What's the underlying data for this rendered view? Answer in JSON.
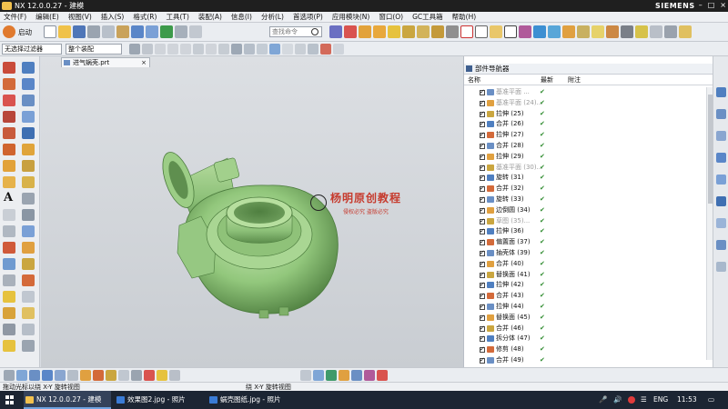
{
  "window": {
    "title": "NX 12.0.0.27 - 建模",
    "brand": "SIEMENS",
    "controls": [
      "–",
      "□",
      "×"
    ]
  },
  "menu": [
    "文件(F)",
    "编辑(E)",
    "视图(V)",
    "插入(S)",
    "格式(R)",
    "工具(T)",
    "装配(A)",
    "信息(I)",
    "分析(L)",
    "首选项(P)",
    "应用模块(N)",
    "窗口(O)",
    "GC工具箱",
    "帮助(H)"
  ],
  "toolbar": {
    "start_label": "启动",
    "search_placeholder": "查找命令",
    "filter_label": "无选择过滤器",
    "assembly_label": "整个装配"
  },
  "document_tab": {
    "label": "进气蜗壳.prt",
    "close": "×"
  },
  "watermark": {
    "title": "杨明原创教程",
    "subtitle": "侵权必究 盗版必究"
  },
  "navigator": {
    "title": "部件导航器",
    "columns": [
      "名称",
      "最新",
      "附注"
    ],
    "rows": [
      {
        "name": "基准平面 ...",
        "grey": true
      },
      {
        "name": "基准平面 (24)...",
        "grey": true
      },
      {
        "name": "拉伸 (25)",
        "grey": false
      },
      {
        "name": "合并 (26)",
        "grey": false
      },
      {
        "name": "拉伸 (27)",
        "grey": false
      },
      {
        "name": "合并 (28)",
        "grey": false
      },
      {
        "name": "拉伸 (29)",
        "grey": false
      },
      {
        "name": "基准平面 (30)...",
        "grey": true
      },
      {
        "name": "旋转 (31)",
        "grey": false
      },
      {
        "name": "合并 (32)",
        "grey": false
      },
      {
        "name": "旋转 (33)",
        "grey": false
      },
      {
        "name": "边倒圆 (34)",
        "grey": false
      },
      {
        "name": "草图 (35)...",
        "grey": true
      },
      {
        "name": "拉伸 (36)",
        "grey": false
      },
      {
        "name": "偏置面 (37)",
        "grey": false
      },
      {
        "name": "抽壳体 (39)",
        "grey": false
      },
      {
        "name": "合并 (40)",
        "grey": false
      },
      {
        "name": "替换面 (41)",
        "grey": false
      },
      {
        "name": "拉伸 (42)",
        "grey": false
      },
      {
        "name": "合并 (43)",
        "grey": false
      },
      {
        "name": "拉伸 (44)",
        "grey": false
      },
      {
        "name": "替换面 (45)",
        "grey": false
      },
      {
        "name": "合并 (46)",
        "grey": false
      },
      {
        "name": "拆分体 (47)",
        "grey": false
      },
      {
        "name": "修剪 (48)",
        "grey": false
      },
      {
        "name": "合并 (49)",
        "grey": false
      }
    ]
  },
  "status": {
    "left": "拖动光标以绕 X-Y 旋转视图",
    "center": "绕 X-Y 旋转视图"
  },
  "taskbar": {
    "items": [
      {
        "label": "NX 12.0.0.27 - 建模",
        "active": true
      },
      {
        "label": "效果图2.jpg - 照片",
        "active": false
      },
      {
        "label": "蜗壳图纸.jpg - 照片",
        "active": false
      }
    ],
    "lang": "ENG",
    "time": "11:53"
  },
  "colors": {
    "part_green": "#92c77c",
    "check_green": "#2e8b2e",
    "taskbar": "#1c2533"
  }
}
